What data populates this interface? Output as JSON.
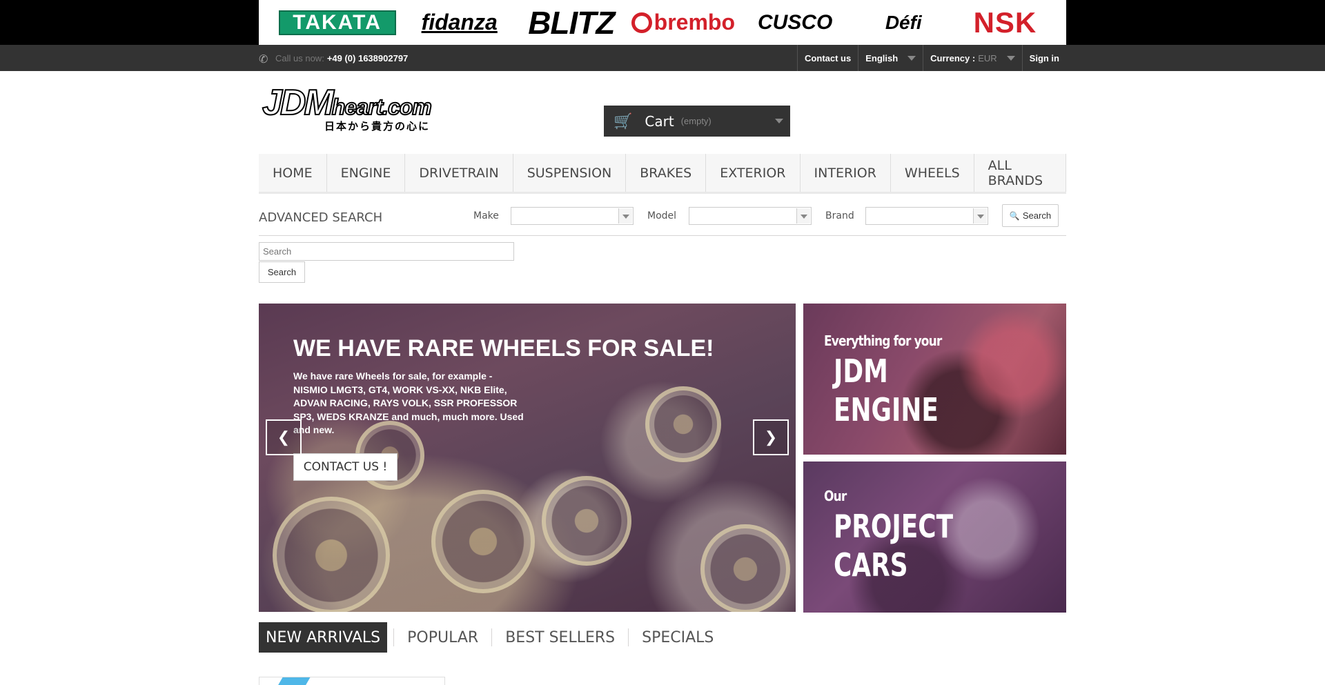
{
  "brands": [
    "TAKATA",
    "fidanza",
    "BLITZ",
    "brembo",
    "CUSCO",
    "Défi",
    "NSK"
  ],
  "topbar": {
    "call_label": "Call us now:",
    "phone": "+49 (0) 1638902797",
    "contact": "Contact us",
    "language": "English",
    "currency_label": "Currency :",
    "currency_value": "EUR",
    "sign_in": "Sign in"
  },
  "header": {
    "logo_main": "JDM",
    "logo_suffix": "heart.com",
    "logo_sub": "日本から貴方の心に",
    "cart_label": "Cart",
    "cart_status": "(empty)"
  },
  "menu": [
    "Home",
    "Engine",
    "Drivetrain",
    "Suspension",
    "Brakes",
    "Exterior",
    "Interior",
    "Wheels",
    "All brands"
  ],
  "advanced_search": {
    "title": "ADVANCED SEARCH",
    "make_label": "Make",
    "model_label": "Model",
    "brand_label": "Brand",
    "button": "Search"
  },
  "search": {
    "placeholder": "Search",
    "button": "Search"
  },
  "slide": {
    "title": "We have rare Wheels for sale!",
    "text": "We have rare Wheels for sale, for example - NISMIO LMGT3, GT4, WORK VS-XX, NKB Elite, ADVAN RACING, RAYS VOLK, SSR PROFESSOR SP3, WEDS KRANZE and much, much more. Used and new.",
    "button": "CONTACT US !"
  },
  "banners": [
    {
      "small": "Everything for your",
      "big1": "JDM",
      "big2": "ENGINE"
    },
    {
      "small": "Our",
      "big1": "PROJECT",
      "big2": "CARS"
    }
  ],
  "tabs": [
    "New arrivals",
    "Popular",
    "Best Sellers",
    "Specials"
  ],
  "colors": {
    "dark": "#333333",
    "brembo_red": "#d3202a",
    "takata_green": "#139a6a"
  }
}
